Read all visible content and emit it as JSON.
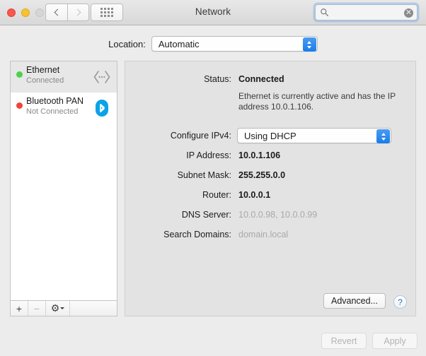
{
  "window": {
    "title": "Network",
    "traffic_lights": [
      "close-button",
      "minimize-button",
      "zoom-button"
    ],
    "nav": {
      "back_icon": "chevron-left-icon",
      "forward_icon": "chevron-right-icon"
    },
    "grid_icon": "show-all-preferences-icon"
  },
  "search": {
    "icon": "search-icon",
    "value": "",
    "placeholder": "",
    "clear_label": "✕"
  },
  "location": {
    "label": "Location:",
    "value": "Automatic"
  },
  "sidebar": {
    "services": [
      {
        "name": "Ethernet",
        "state": "Connected",
        "dot_color": "#4cd24c",
        "icon": "ethernet-icon",
        "selected": true
      },
      {
        "name": "Bluetooth PAN",
        "state": "Not Connected",
        "dot_color": "#f0453a",
        "icon": "bluetooth-icon",
        "selected": false
      }
    ],
    "footer": {
      "add_label": "+",
      "remove_label": "−",
      "gear_label": "⚙"
    }
  },
  "detail": {
    "status_label": "Status:",
    "status_value": "Connected",
    "status_description": "Ethernet is currently active and has the IP address 10.0.1.106.",
    "configure_label": "Configure IPv4:",
    "configure_value": "Using DHCP",
    "fields": [
      {
        "label": "IP Address:",
        "value": "10.0.1.106",
        "muted": false
      },
      {
        "label": "Subnet Mask:",
        "value": "255.255.0.0",
        "muted": false
      },
      {
        "label": "Router:",
        "value": "10.0.0.1",
        "muted": false
      },
      {
        "label": "DNS Server:",
        "value": "10.0.0.98, 10.0.0.99",
        "muted": true
      },
      {
        "label": "Search Domains:",
        "value": "domain.local",
        "muted": true
      }
    ],
    "advanced_label": "Advanced...",
    "help_label": "?"
  },
  "footer": {
    "revert_label": "Revert",
    "apply_label": "Apply"
  },
  "colors": {
    "accent": "#1a7de8",
    "connected": "#4cd24c",
    "disconnected": "#f0453a",
    "bluetooth": "#0aa3e8"
  }
}
